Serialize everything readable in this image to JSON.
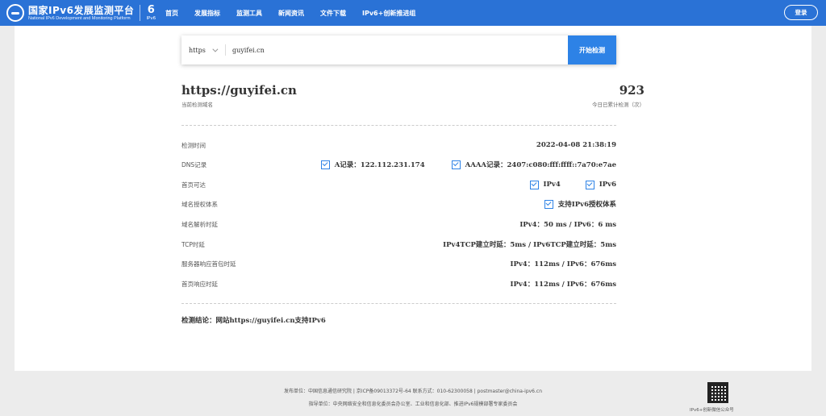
{
  "header": {
    "logo_title": "国家IPv6发展监测平台",
    "logo_subtitle": "National IPv6 Development and Monitoring Platform",
    "badge_glyph": "6",
    "badge_label": "IPv6",
    "nav": [
      "首页",
      "发展指标",
      "监测工具",
      "新闻资讯",
      "文件下载",
      "IPv6+创新推进组"
    ],
    "login_label": "登录",
    "bg_color": "#2a72d6"
  },
  "search": {
    "protocol": "https",
    "value": "guyifei.cn",
    "button_label": "开始检测",
    "button_color": "#2d82e6"
  },
  "result": {
    "domain": "https://guyifei.cn",
    "domain_label": "当前检测域名",
    "count": "923",
    "count_label": "今日已累计检测（次）"
  },
  "rows": {
    "time": {
      "label": "检测时间",
      "value": "2022-04-08 21:38:19"
    },
    "dns": {
      "label": "DNS记录",
      "a": "A记录：122.112.231.174",
      "aaaa": "AAAA记录：2407:c080:fff:ffff::7a70:e7ae"
    },
    "home": {
      "label": "首页可达",
      "ipv4": "IPv4",
      "ipv6": "IPv6"
    },
    "auth": {
      "label": "域名授权体系",
      "value": "支持IPv6授权体系"
    },
    "resolve": {
      "label": "域名解析时延",
      "value": "IPv4：50 ms / IPv6：6 ms"
    },
    "tcp": {
      "label": "TCP时延",
      "value": "IPv4TCP建立时延：5ms / IPv6TCP建立时延：5ms"
    },
    "first_packet": {
      "label": "服务器响应首包时延",
      "value": "IPv4：112ms / IPv6：676ms"
    },
    "home_resp": {
      "label": "首页响应时延",
      "value": "IPv4：112ms / IPv6：676ms"
    }
  },
  "conclusion": "检测结论：网站https://guyifei.cn支持IPv6",
  "footer": {
    "line1": "发布单位：中国信息通信研究院 | 京ICP备09013372号-64 联系方式：010-62300058 | postmaster@china-ipv6.cn",
    "line2": "指导单位：中央网络安全和信息化委员会办公室、工业和信息化部、推进IPv6规模部署专家委员会",
    "qr_label": "IPv6+创新微信公众号"
  }
}
